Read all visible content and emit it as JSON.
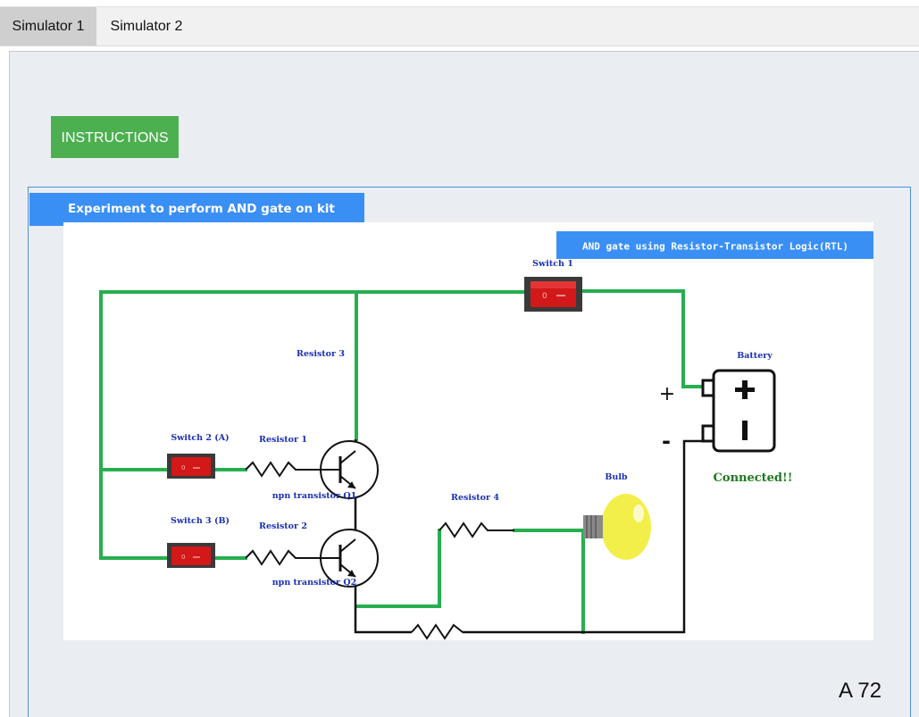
{
  "tabs": [
    {
      "label": "Simulator 1",
      "active": true
    },
    {
      "label": "Simulator 2",
      "active": false
    }
  ],
  "instructions_button": "INSTRUCTIONS",
  "experiment_title": "Experiment to perform AND gate on kit",
  "circuit": {
    "title": "AND gate using Resistor-Transistor Logic(RTL)",
    "labels": {
      "switch1": "Switch 1",
      "switch2": "Switch 2 (A)",
      "switch3": "Switch 3 (B)",
      "resistor1": "Resistor 1",
      "resistor2": "Resistor 2",
      "resistor3": "Resistor 3",
      "resistor4": "Resistor 4",
      "transistor_q1": "npn transistor Q1",
      "transistor_q2": "npn transistor Q2",
      "bulb": "Bulb",
      "battery": "Battery",
      "plus_terminal": "+",
      "minus_terminal": "-"
    },
    "status": "Connected!!",
    "colors": {
      "wire_active": "#27ae4f",
      "wire_inactive": "#111111",
      "switch": "#d21818",
      "bulb": "#f2ef4a",
      "status": "#1c7a1c",
      "label": "#1a2fb5",
      "header": "#3a8ff5",
      "button": "#4caf50"
    }
  },
  "page_number": "A 72"
}
